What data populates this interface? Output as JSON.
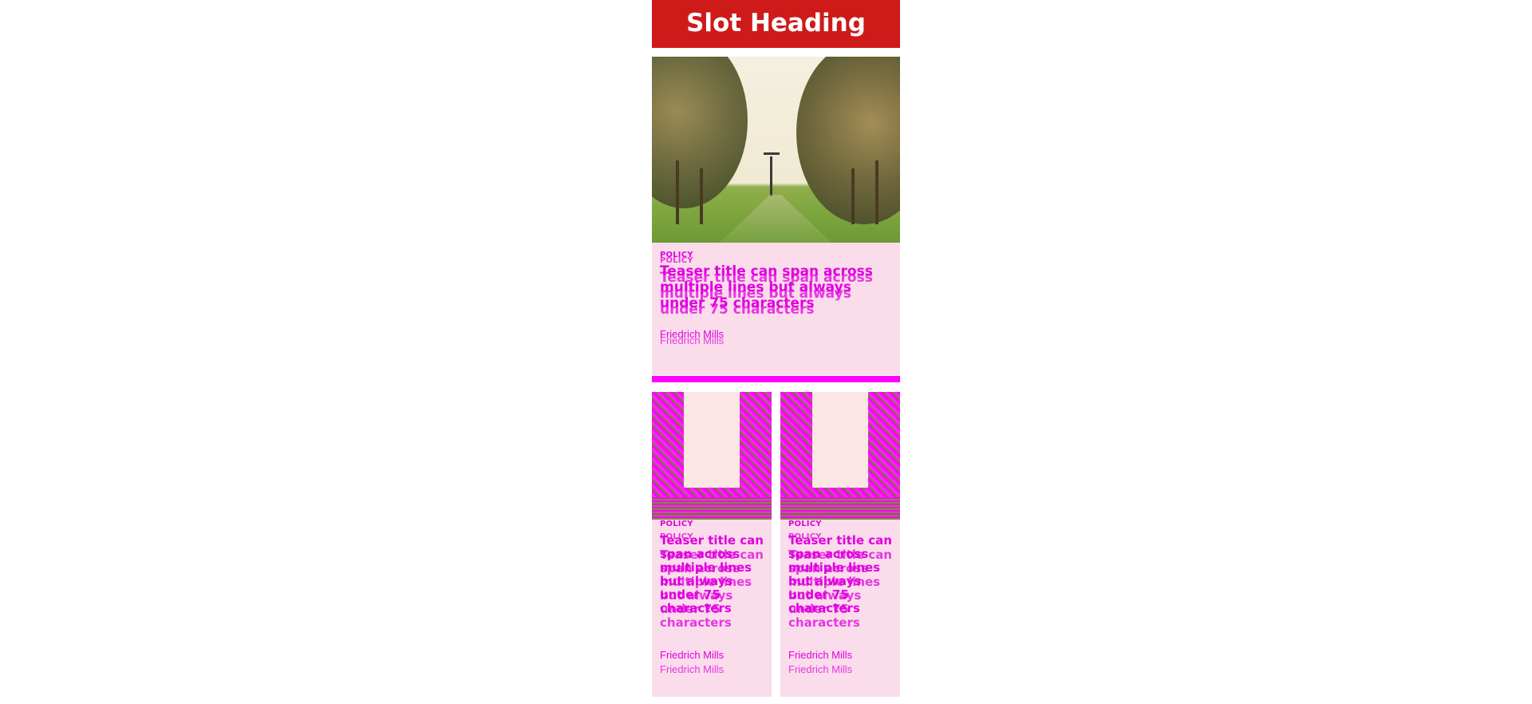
{
  "slot_heading": "Slot Heading",
  "colors": {
    "heading_bg": "#cf1a1a",
    "card_bg": "#fadceb",
    "accent": "#ff00ff"
  },
  "hero": {
    "tag": "POLICY",
    "title": "Teaser title can span across multiple lines but always under 75 characters",
    "author": "Friedrich Mills"
  },
  "cards": [
    {
      "tag": "POLICY",
      "title": "Teaser title can span across multiple lines but always under 75 characters",
      "author": "Friedrich Mills"
    },
    {
      "tag": "POLICY",
      "title": "Teaser title can span across multiple lines but always under 75 characters",
      "author": "Friedrich Mills"
    }
  ]
}
